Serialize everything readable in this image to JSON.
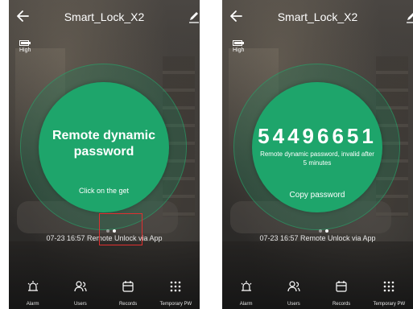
{
  "accent_color": "#1ea56b",
  "screens": [
    {
      "header": {
        "title": "Smart_Lock_X2",
        "back_icon": "arrow-left-icon",
        "edit_icon": "pencil-icon"
      },
      "battery": {
        "label": "High",
        "level": 0.9
      },
      "main": {
        "title": "Remote dynamic password",
        "action_label": "Click on the get"
      },
      "status": {
        "text": "07-23 16:57  Remote Unlock via App"
      },
      "tabs": [
        {
          "label": "Alarm",
          "icon": "alarm-icon"
        },
        {
          "label": "Users",
          "icon": "users-icon"
        },
        {
          "label": "Records",
          "icon": "calendar-icon"
        },
        {
          "label": "Temporary PW",
          "icon": "keypad-icon"
        }
      ]
    },
    {
      "header": {
        "title": "Smart_Lock_X2",
        "back_icon": "arrow-left-icon",
        "edit_icon": "pencil-icon"
      },
      "battery": {
        "label": "High",
        "level": 0.9
      },
      "main": {
        "code": "54496651",
        "note": "Remote dynamic password, invalid after 5 minutes",
        "action_label": "Copy password"
      },
      "status": {
        "text": "07-23 16:57  Remote Unlock via App"
      },
      "tabs": [
        {
          "label": "Alarm",
          "icon": "alarm-icon"
        },
        {
          "label": "Users",
          "icon": "users-icon"
        },
        {
          "label": "Records",
          "icon": "calendar-icon"
        },
        {
          "label": "Temporary PW",
          "icon": "keypad-icon"
        }
      ]
    }
  ]
}
